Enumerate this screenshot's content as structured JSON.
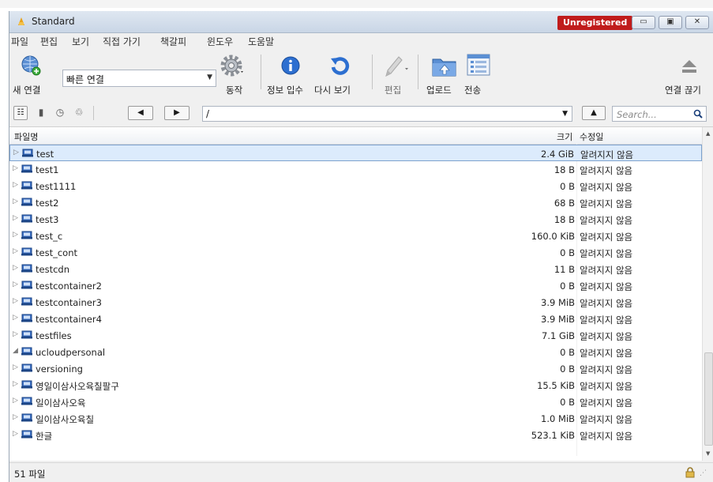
{
  "window": {
    "title": "Standard",
    "unregistered": "Unregistered"
  },
  "menu": [
    "파일",
    "편집",
    "보기",
    "직접 가기",
    "책갈피",
    "윈도우",
    "도움말"
  ],
  "toolbar": {
    "new_connection": "새 연결",
    "quick_connect_value": "빠른 연결",
    "action": "동작",
    "info": "정보 입수",
    "refresh": "다시 보기",
    "edit": "편집",
    "upload": "업로드",
    "transfers": "전송",
    "disconnect": "연결 끊기"
  },
  "navbar": {
    "path": "/",
    "search_placeholder": "Search..."
  },
  "columns": {
    "name": "파일명",
    "size": "크기",
    "modified": "수정일"
  },
  "files": [
    {
      "name": "test",
      "size": "2.4 GiB",
      "modified": "알려지지 않음",
      "expanded": false,
      "selected": true
    },
    {
      "name": "test1",
      "size": "18 B",
      "modified": "알려지지 않음",
      "expanded": false
    },
    {
      "name": "test1111",
      "size": "0 B",
      "modified": "알려지지 않음",
      "expanded": false
    },
    {
      "name": "test2",
      "size": "68 B",
      "modified": "알려지지 않음",
      "expanded": false
    },
    {
      "name": "test3",
      "size": "18 B",
      "modified": "알려지지 않음",
      "expanded": false
    },
    {
      "name": "test_c",
      "size": "160.0 KiB",
      "modified": "알려지지 않음",
      "expanded": false
    },
    {
      "name": "test_cont",
      "size": "0 B",
      "modified": "알려지지 않음",
      "expanded": false
    },
    {
      "name": "testcdn",
      "size": "11 B",
      "modified": "알려지지 않음",
      "expanded": false
    },
    {
      "name": "testcontainer2",
      "size": "0 B",
      "modified": "알려지지 않음",
      "expanded": false
    },
    {
      "name": "testcontainer3",
      "size": "3.9 MiB",
      "modified": "알려지지 않음",
      "expanded": false
    },
    {
      "name": "testcontainer4",
      "size": "3.9 MiB",
      "modified": "알려지지 않음",
      "expanded": false
    },
    {
      "name": "testfiles",
      "size": "7.1 GiB",
      "modified": "알려지지 않음",
      "expanded": false
    },
    {
      "name": "ucloudpersonal",
      "size": "0 B",
      "modified": "알려지지 않음",
      "expanded": true
    },
    {
      "name": "versioning",
      "size": "0 B",
      "modified": "알려지지 않음",
      "expanded": false
    },
    {
      "name": "영일이삼사오육칠팔구",
      "size": "15.5 KiB",
      "modified": "알려지지 않음",
      "expanded": false
    },
    {
      "name": "일이삼사오육",
      "size": "0 B",
      "modified": "알려지지 않음",
      "expanded": false
    },
    {
      "name": "일이삼사오육칠",
      "size": "1.0 MiB",
      "modified": "알려지지 않음",
      "expanded": false
    },
    {
      "name": "한글",
      "size": "523.1 KiB",
      "modified": "알려지지 않음",
      "expanded": false
    }
  ],
  "status": "51 파일"
}
